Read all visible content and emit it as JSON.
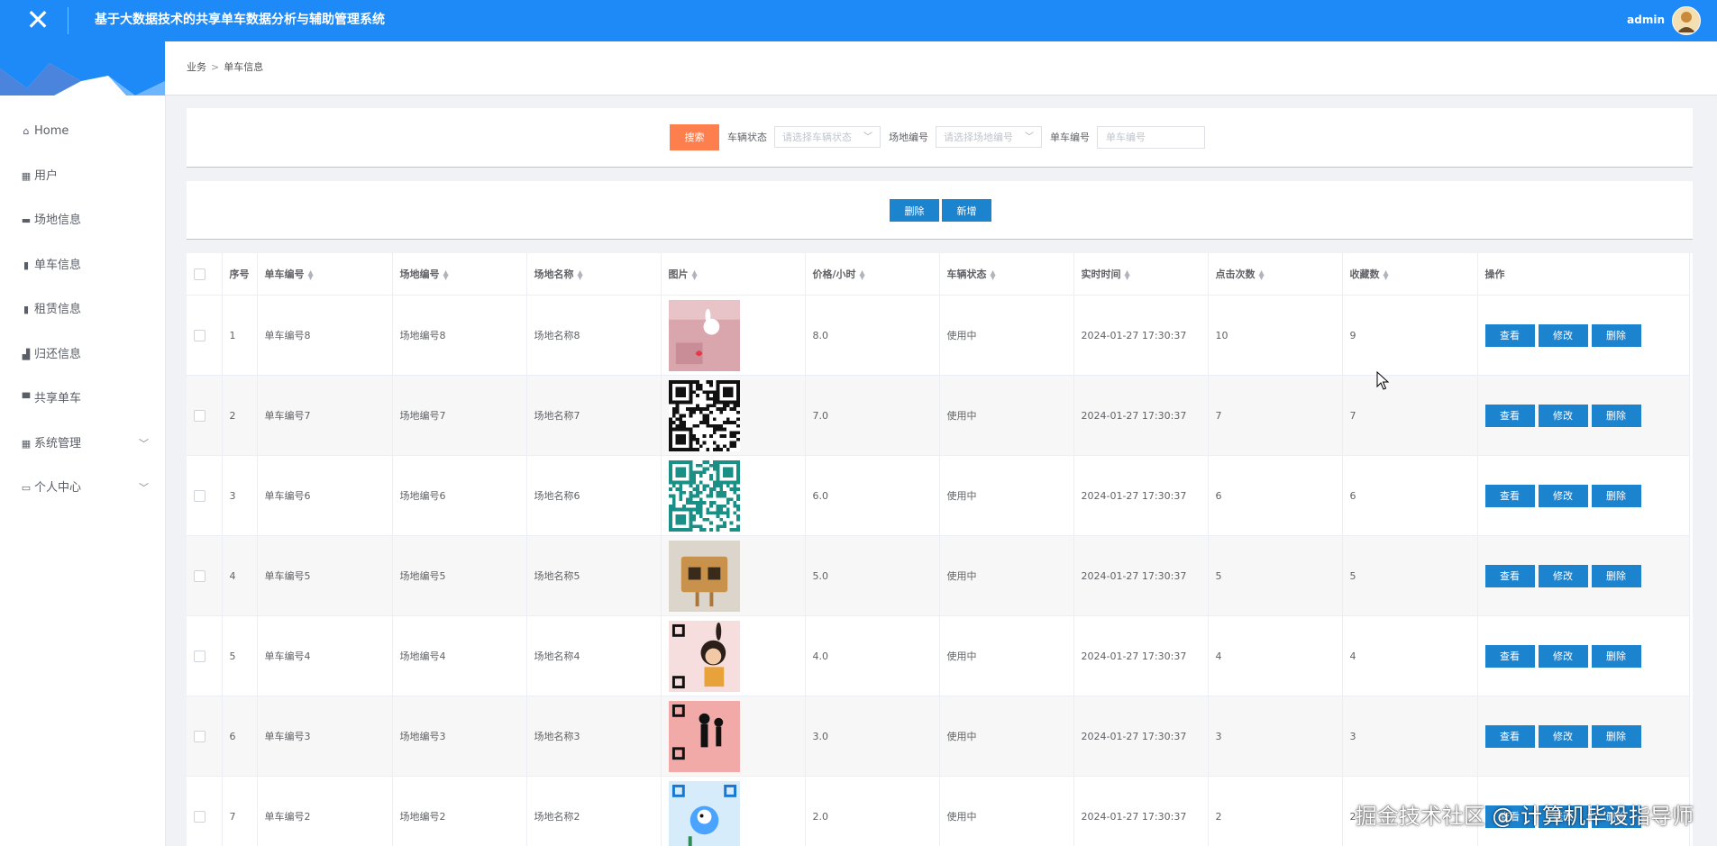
{
  "header": {
    "title": "基于大数据技术的共享单车数据分析与辅助管理系统",
    "username": "admin",
    "brand_color": "#1e8af7"
  },
  "sidebar": {
    "items": [
      {
        "label": "Home",
        "icon": "home-icon"
      },
      {
        "label": "用户",
        "icon": "grid-icon"
      },
      {
        "label": "场地信息",
        "icon": "briefcase-icon"
      },
      {
        "label": "单车信息",
        "icon": "clipboard-icon"
      },
      {
        "label": "租赁信息",
        "icon": "clipboard-icon"
      },
      {
        "label": "归还信息",
        "icon": "thumbs-up-icon"
      },
      {
        "label": "共享单车",
        "icon": "bookmark-icon"
      },
      {
        "label": "系统管理",
        "icon": "grid-icon",
        "expandable": true
      },
      {
        "label": "个人中心",
        "icon": "window-icon",
        "expandable": true
      }
    ]
  },
  "breadcrumb": {
    "root": "业务",
    "separator": ">",
    "current": "单车信息"
  },
  "search": {
    "button_label": "搜索",
    "status_label": "车辆状态",
    "status_placeholder": "请选择车辆状态",
    "site_label": "场地编号",
    "site_placeholder": "请选择场地编号",
    "bike_label": "单车编号",
    "bike_placeholder": "单车编号",
    "button_color": "#fe7f4e"
  },
  "actions": {
    "delete_label": "删除",
    "add_label": "新增",
    "button_color": "#1c83cf"
  },
  "table": {
    "columns": [
      "序号",
      "单车编号",
      "场地编号",
      "场地名称",
      "图片",
      "价格/小时",
      "车辆状态",
      "实时时间",
      "点击次数",
      "收藏数",
      "操作"
    ],
    "op_labels": {
      "view": "查看",
      "edit": "修改",
      "delete": "删除"
    },
    "rows": [
      {
        "index": "1",
        "bike_no": "单车编号8",
        "site_no": "场地编号8",
        "site_name": "场地名称8",
        "image": "cartoon-bunny",
        "price": "8.0",
        "status": "使用中",
        "time": "2024-01-27 17:30:37",
        "clicks": "10",
        "favorites": "9"
      },
      {
        "index": "2",
        "bike_no": "单车编号7",
        "site_no": "场地编号7",
        "site_name": "场地名称7",
        "image": "qr-black",
        "price": "7.0",
        "status": "使用中",
        "time": "2024-01-27 17:30:37",
        "clicks": "7",
        "favorites": "7"
      },
      {
        "index": "3",
        "bike_no": "单车编号6",
        "site_no": "场地编号6",
        "site_name": "场地名称6",
        "image": "qr-teal",
        "price": "6.0",
        "status": "使用中",
        "time": "2024-01-27 17:30:37",
        "clicks": "6",
        "favorites": "6"
      },
      {
        "index": "4",
        "bike_no": "单车编号5",
        "site_no": "场地编号5",
        "site_name": "场地名称5",
        "image": "wooden-qr-sign",
        "price": "5.0",
        "status": "使用中",
        "time": "2024-01-27 17:30:37",
        "clicks": "5",
        "favorites": "5"
      },
      {
        "index": "5",
        "bike_no": "单车编号4",
        "site_no": "场地编号4",
        "site_name": "场地名称4",
        "image": "qr-girl-cartoon",
        "price": "4.0",
        "status": "使用中",
        "time": "2024-01-27 17:30:37",
        "clicks": "4",
        "favorites": "4"
      },
      {
        "index": "6",
        "bike_no": "单车编号3",
        "site_no": "场地编号3",
        "site_name": "场地名称3",
        "image": "qr-couple-pink",
        "price": "3.0",
        "status": "使用中",
        "time": "2024-01-27 17:30:37",
        "clicks": "3",
        "favorites": "3"
      },
      {
        "index": "7",
        "bike_no": "单车编号2",
        "site_no": "场地编号2",
        "site_name": "场地名称2",
        "image": "qr-blue-cartoon",
        "price": "2.0",
        "status": "使用中",
        "time": "2024-01-27 17:30:37",
        "clicks": "2",
        "favorites": "2"
      }
    ]
  },
  "watermark": "掘金技术社区 @ 计算机毕设指导师"
}
